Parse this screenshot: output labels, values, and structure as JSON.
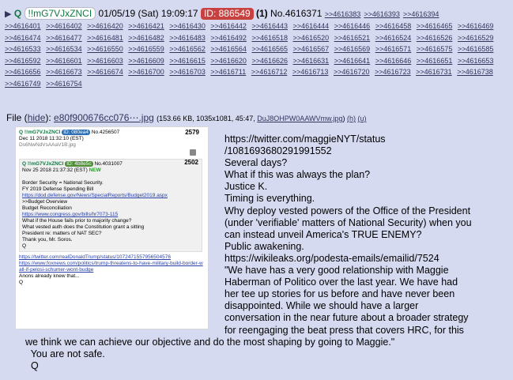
{
  "header": {
    "arrow": "▶",
    "name": "Q",
    "tripcode": "!!mG7VJxZNCI",
    "datetime": "01/05/19 (Sat) 19:09:17",
    "id_label": "ID: 886549",
    "count": "(1)",
    "post_no": "No.4616371"
  },
  "refs": [
    ">>4616383",
    ">>4616393",
    ">>4616394",
    ">>4616401",
    ">>4616402",
    ">>4616420",
    ">>4616421",
    ">>4616430",
    ">>4616442",
    ">>4616443",
    ">>4616444",
    ">>4616446",
    ">>4616458",
    ">>4616465",
    ">>4616469",
    ">>4616474",
    ">>4616477",
    ">>4616481",
    ">>4616482",
    ">>4616483",
    ">>4616492",
    ">>4616518",
    ">>4616520",
    ">>4616521",
    ">>4616524",
    ">>4616526",
    ">>4616529",
    ">>4616533",
    ">>4616534",
    ">>4616550",
    ">>4616559",
    ">>4616562",
    ">>4616564",
    ">>4616565",
    ">>4616567",
    ">>4616569",
    ">>4616571",
    ">>4616575",
    ">>4616585",
    ">>4616592",
    ">>4616601",
    ">>4616603",
    ">>4616609",
    ">>4616615",
    ">>4616620",
    ">>4616626",
    ">>4616631",
    ">>4616641",
    ">>4616646",
    ">>4616651",
    ">>4616653",
    ">>4616656",
    ">>4616673",
    ">>4616674",
    ">>4616700",
    ">>4616703",
    ">>4616711",
    ">>4616712",
    ">>4616713",
    ">>4616720",
    ">>4616723",
    ">>4616731",
    ">>4616738",
    ">>4616749",
    ">>4616754"
  ],
  "file": {
    "label": "File",
    "hide": "hide",
    "filename": "e80f900676cc076⋯.jpg",
    "meta": "(153.66 KB, 1035x1081, 45:47,",
    "origname": "DuJ8OHPW0AAWVmw.jpg",
    "h": "(h)",
    "u": "(u)"
  },
  "thumb": {
    "p1_name": "Q !!mG7VJxZNCI",
    "p1_id": "ID: 080ea4",
    "p1_no": "No.4256507",
    "p1_num": "2579",
    "p1_date": "Dec 11 2018 11:32:10 (EST)",
    "p1_file": "Ds6NwNdVsAAaV1B.jpg",
    "p2_name": "Q !!mG7VJxZNCI",
    "p2_id": "ID: 4b8e5c",
    "p2_no": "No.4031007",
    "p2_num": "2502",
    "p2_date": "Nov 25 2018 21:37:32 (EST)",
    "p2_new": "NEW",
    "p2_lines": [
      "Border Security = National Security.",
      "FY 2019 Defense Spending Bill"
    ],
    "p2_link1": "https://dod.defense.gov/News/SpecialReports/Budget2019.aspx",
    "p2_lines2": [
      ">>Budget Overview",
      "Budget Reconciliation"
    ],
    "p2_link2": "https://www.congress.gov/bills/hr7073-115",
    "p2_lines3": [
      "What if the House fails prior to majority change?",
      "What vested auth does the Constitution grant a sitting",
      "President re: matters of NAT SEC?",
      "Thank you, Mr. Soros.",
      "Q"
    ],
    "p1_link1": "https://twitter.com/realDonaldTrump/status/1072471557956504576",
    "p1_link2": "https://www.foxnews.com/politics/trump-threatens-to-have-military-build-border-wall-if-pelosi-schumer-wont-budge",
    "p1_tail": [
      "Anons already knew that...",
      "Q"
    ]
  },
  "body": {
    "lines_indented": [
      "https://twitter.com/maggieNYT/status",
      "/1081693680291991552",
      "Several days?",
      "What if this was always the plan?",
      "Justice K.",
      "Timing is everything.",
      "Why deploy vested powers of the Office of the President",
      "(under 'verifiable' matters of National Security) when you",
      "can instead unveil America's TRUE ENEMY?",
      "Public awakening.",
      "https://wikileaks.org/podesta-emails/emailid/7524",
      "\"We have has a very good relationship with Maggie",
      "Haberman of Politico over the last year. We have had",
      "her tee up stories for us before and have never been",
      "disappointed. While we should have a larger",
      "conversation in the near future about a broader strategy",
      "for reengaging the beat press that covers HRC, for this"
    ],
    "lines_full": [
      "we think we can achieve our objective and do the most shaping by going to Maggie.\"",
      "  You are not safe.",
      "  Q"
    ]
  }
}
